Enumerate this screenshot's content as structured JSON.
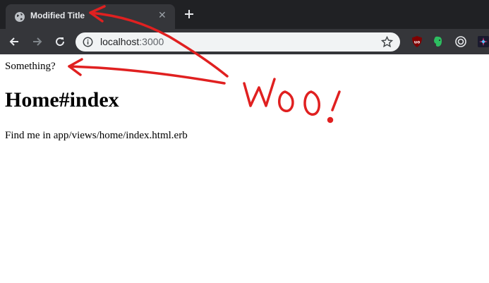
{
  "browser": {
    "tab": {
      "title": "Modified Title"
    },
    "address_bar": {
      "host": "localhost",
      "port": ":3000"
    }
  },
  "page": {
    "text": "Something?",
    "heading": "Home#index",
    "body": "Find me in app/views/home/index.html.erb"
  },
  "annotation": {
    "text": "WOO!",
    "color": "#e02020"
  },
  "icons": [
    "globe-icon",
    "close-icon",
    "plus-icon",
    "back-arrow-icon",
    "forward-arrow-icon",
    "reload-icon",
    "info-icon",
    "star-icon",
    "ublock-extension-icon",
    "evernote-extension-icon",
    "target-extension-icon",
    "colorful-extension-icon"
  ]
}
